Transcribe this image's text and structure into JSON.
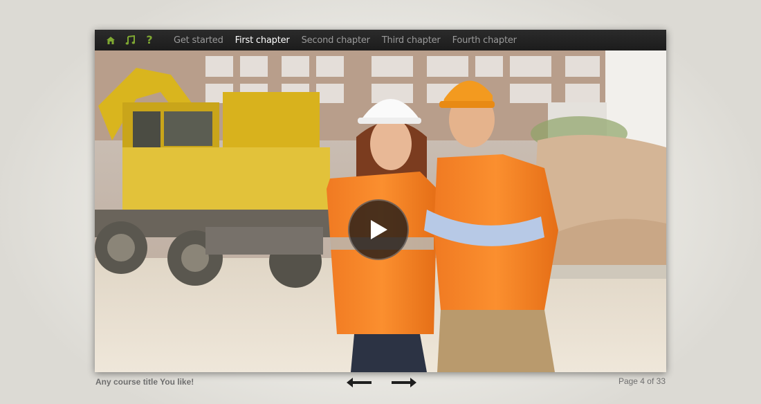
{
  "toolbar": {
    "icons": [
      {
        "name": "home-icon",
        "color": "#7fa832"
      },
      {
        "name": "music-note-icon",
        "color": "#7fa832"
      },
      {
        "name": "help-icon",
        "color": "#7fa832",
        "glyph": "?"
      }
    ]
  },
  "nav": {
    "items": [
      {
        "label": "Get started",
        "active": false
      },
      {
        "label": "First chapter",
        "active": true
      },
      {
        "label": "Second chapter",
        "active": false
      },
      {
        "label": "Third chapter",
        "active": false
      },
      {
        "label": "Fourth chapter",
        "active": false
      }
    ]
  },
  "video": {
    "play_icon": "play-icon"
  },
  "footer": {
    "course_title": "Any course title You like!",
    "page_indicator": "Page 4 of 33",
    "prev_icon": "arrow-left-icon",
    "next_icon": "arrow-right-icon"
  },
  "colors": {
    "accent": "#7fa832",
    "topbar": "#222222",
    "nav_active": "#ffffff",
    "nav_inactive": "#9a9a9a",
    "footer_text": "#6e6e6e"
  }
}
